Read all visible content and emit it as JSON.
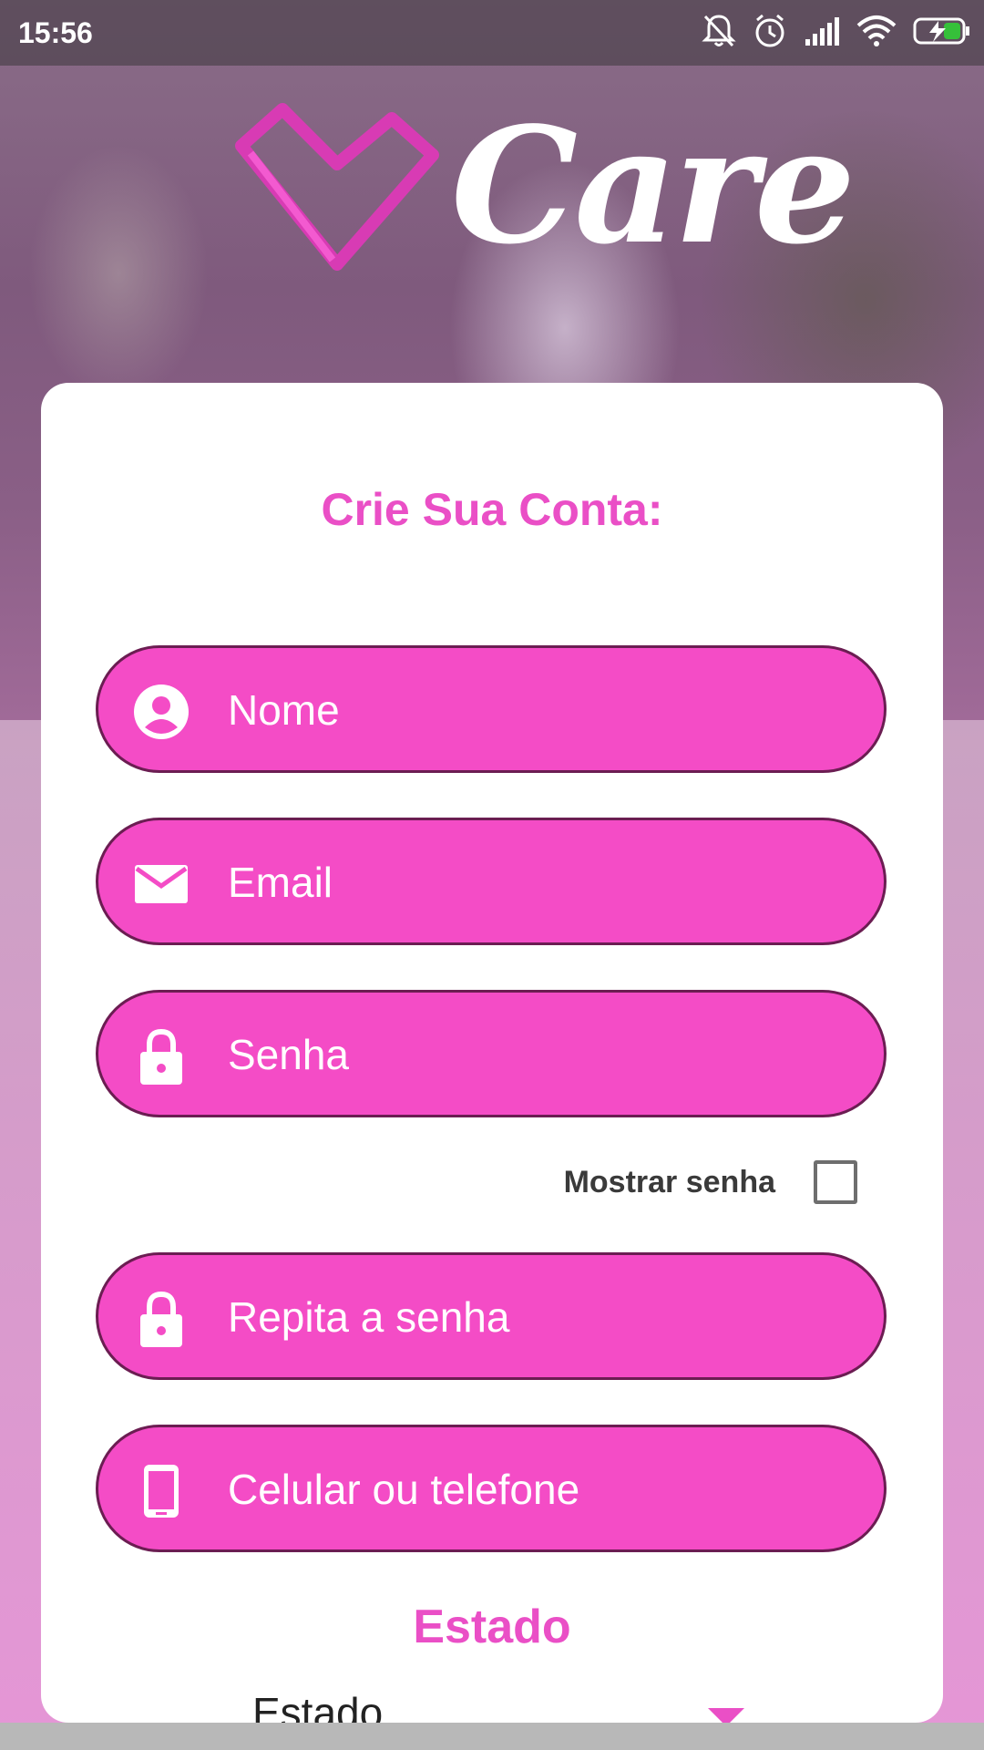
{
  "status_bar": {
    "time": "15:56",
    "icons": [
      "muted-bell-icon",
      "alarm-icon",
      "signal-icon",
      "wifi-icon",
      "battery-charging-icon"
    ]
  },
  "logo": {
    "brand": "Care",
    "icon": "heart-icon"
  },
  "form": {
    "title": "Crie Sua Conta:",
    "fields": {
      "nome": {
        "placeholder": "Nome",
        "icon": "user-circle-icon"
      },
      "email": {
        "placeholder": "Email",
        "icon": "envelope-icon"
      },
      "senha": {
        "placeholder": "Senha",
        "icon": "lock-icon"
      },
      "repita": {
        "placeholder": "Repita a senha",
        "icon": "lock-icon"
      },
      "telefone": {
        "placeholder": "Celular ou telefone",
        "icon": "phone-icon"
      }
    },
    "show_password_label": "Mostrar senha",
    "estado_heading": "Estado",
    "estado_select_value": "Estado"
  },
  "colors": {
    "accent": "#f44cc6",
    "field_border": "#6b1d52",
    "title": "#ea4fc6"
  }
}
